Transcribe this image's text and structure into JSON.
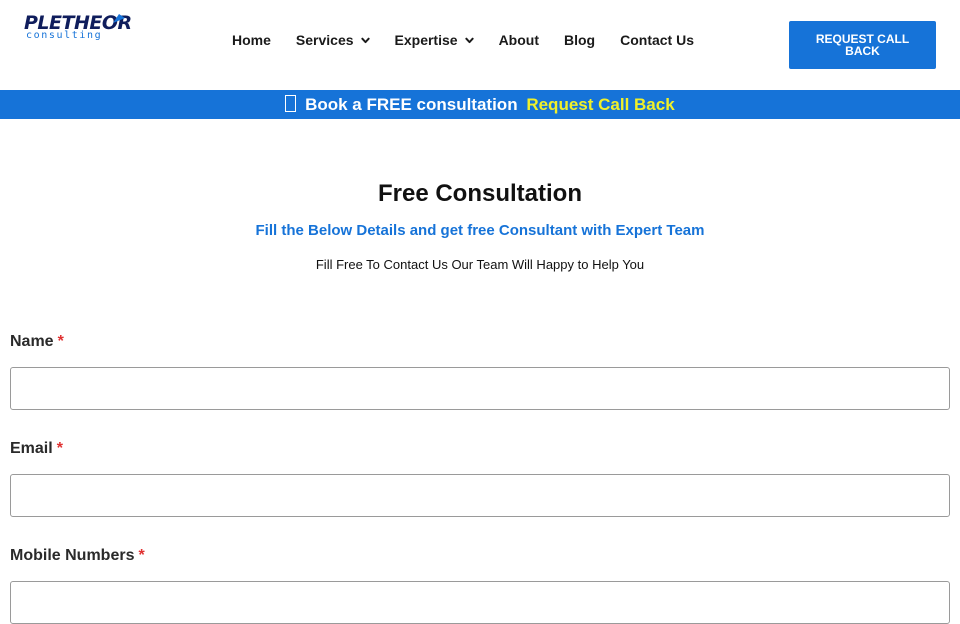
{
  "header": {
    "logo": {
      "name": "PLETHEOR",
      "tagline": "consulting"
    },
    "nav": [
      {
        "label": "Home",
        "has_dropdown": false
      },
      {
        "label": "Services",
        "has_dropdown": true
      },
      {
        "label": "Expertise",
        "has_dropdown": true
      },
      {
        "label": "About",
        "has_dropdown": false
      },
      {
        "label": "Blog",
        "has_dropdown": false
      },
      {
        "label": "Contact Us",
        "has_dropdown": false
      }
    ],
    "cta_label": "REQUEST CALL BACK"
  },
  "banner": {
    "text": "Book a FREE consultation",
    "link_label": "Request Call Back"
  },
  "main": {
    "title": "Free Consultation",
    "subtitle": "Fill the Below Details and get free Consultant with Expert Team",
    "tagline": "Fill Free To Contact Us Our Team Will Happy to Help You"
  },
  "form": {
    "fields": [
      {
        "label": "Name",
        "required_mark": "*",
        "value": ""
      },
      {
        "label": "Email",
        "required_mark": "*",
        "value": ""
      },
      {
        "label": "Mobile Numbers",
        "required_mark": "*",
        "value": ""
      }
    ]
  },
  "colors": {
    "brand_blue": "#1673d8",
    "logo_navy": "#0f1d5c",
    "banner_link": "#f0f02a",
    "required": "#e03131"
  },
  "icons": {
    "dropdown": "chevron-down-icon",
    "banner": "placeholder-glyph-icon",
    "logo": "logo-arrow-mark"
  }
}
